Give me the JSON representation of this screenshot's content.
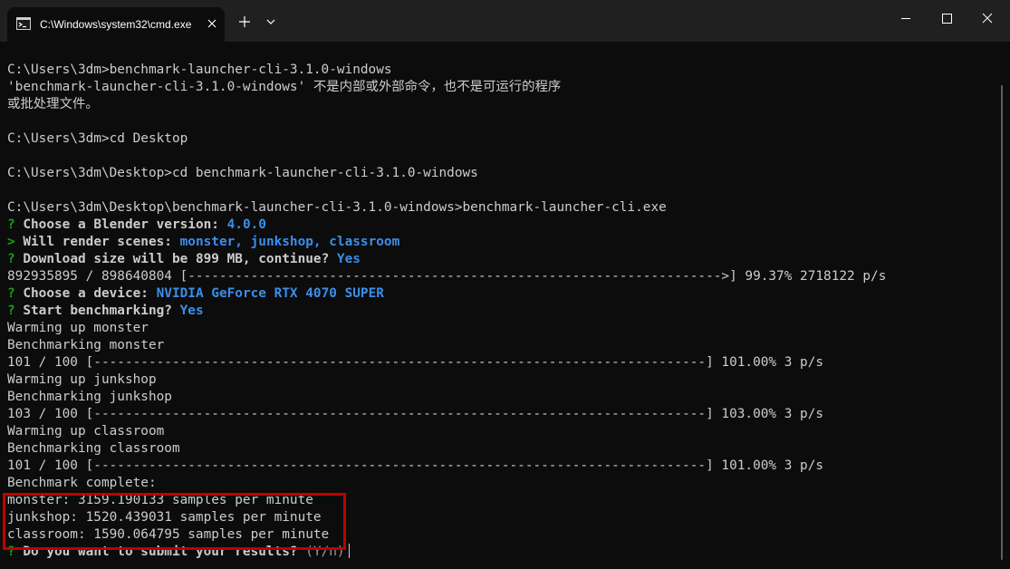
{
  "window": {
    "tab_title": "C:\\Windows\\system32\\cmd.exe",
    "icons": [
      "cmd-icon",
      "close-icon",
      "plus-icon",
      "chevron-down-icon",
      "minimize-icon",
      "maximize-icon",
      "close-icon"
    ]
  },
  "console": {
    "prompt1": "C:\\Users\\3dm>benchmark-launcher-cli-3.1.0-windows",
    "error1": "'benchmark-launcher-cli-3.1.0-windows' 不是内部或外部命令，也不是可运行的程序",
    "error2": "或批处理文件。",
    "prompt2": "C:\\Users\\3dm>cd Desktop",
    "prompt3": "C:\\Users\\3dm\\Desktop>cd benchmark-launcher-cli-3.1.0-windows",
    "prompt4": "C:\\Users\\3dm\\Desktop\\benchmark-launcher-cli-3.1.0-windows>benchmark-launcher-cli.exe",
    "q1_mark": "?",
    "q1_text": "Choose a Blender version:",
    "q1_answer": "4.0.0",
    "q2_mark": ">",
    "q2_text": "Will render scenes:",
    "q2_answer": "monster, junkshop, classroom",
    "q3_mark": "?",
    "q3_text": "Download size will be 899 MB, continue?",
    "q3_answer": "Yes",
    "download_progress": "892935895 / 898640804 [-------------------------------------------------------------------->] 99.37% 2718122 p/s",
    "q4_mark": "?",
    "q4_text": "Choose a device:",
    "q4_answer": "NVIDIA GeForce RTX 4070 SUPER",
    "q5_mark": "?",
    "q5_text": "Start benchmarking?",
    "q5_answer": "Yes",
    "warm_monster": "Warming up monster",
    "bench_monster": "Benchmarking monster",
    "progress_monster": "101 / 100 [------------------------------------------------------------------------------] 101.00% 3 p/s",
    "warm_junkshop": "Warming up junkshop",
    "bench_junkshop": "Benchmarking junkshop",
    "progress_junkshop": "103 / 100 [------------------------------------------------------------------------------] 103.00% 3 p/s",
    "warm_classroom": "Warming up classroom",
    "bench_classroom": "Benchmarking classroom",
    "progress_classroom": "101 / 100 [------------------------------------------------------------------------------] 101.00% 3 p/s",
    "complete": "Benchmark complete:",
    "result_monster": "monster: 3159.190133 samples per minute",
    "result_junkshop": "junkshop: 1520.439031 samples per minute",
    "result_classroom": "classroom: 1590.064795 samples per minute",
    "final_mark": "?",
    "final_text": "Do you want to submit your results?",
    "final_hint": "(Y/n)"
  },
  "colors": {
    "background": "#0c0c0c",
    "text": "#cccccc",
    "question": "#13a10e",
    "answer": "#3b8eea",
    "highlight": "#c00000"
  }
}
